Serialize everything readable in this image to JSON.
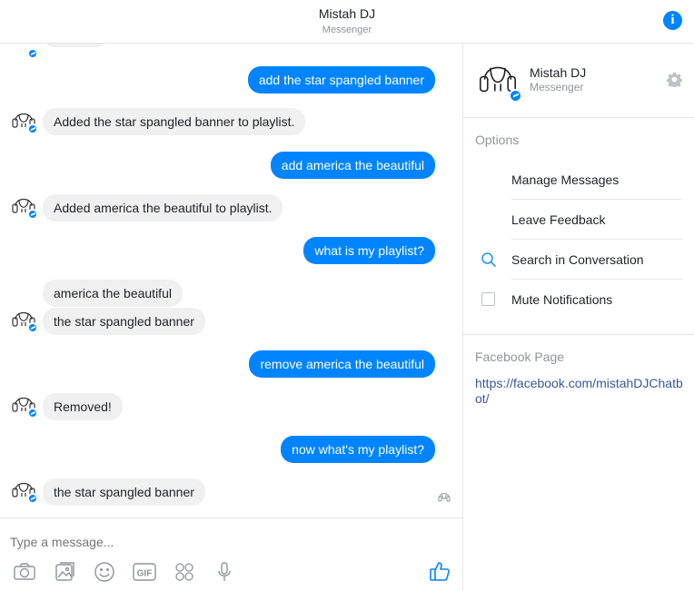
{
  "header": {
    "title": "Mistah DJ",
    "subtitle": "Messenger"
  },
  "conversation": {
    "messages": [
      {
        "direction": "out",
        "text": "add the star spangled banner"
      },
      {
        "direction": "in",
        "text": "Added the star spangled banner to playlist."
      },
      {
        "direction": "out",
        "text": "add america the beautiful"
      },
      {
        "direction": "in",
        "text": "Added america the beautiful to playlist."
      },
      {
        "direction": "out",
        "text": "what is my playlist?"
      },
      {
        "direction": "in",
        "text": "america the beautiful"
      },
      {
        "direction": "in",
        "text": "the star spangled banner"
      },
      {
        "direction": "out",
        "text": "remove america the beautiful"
      },
      {
        "direction": "in",
        "text": "Removed!"
      },
      {
        "direction": "out",
        "text": "now what's my playlist?"
      },
      {
        "direction": "in",
        "text": "the star spangled banner"
      }
    ]
  },
  "composer": {
    "placeholder": "Type a message...",
    "tools": [
      "camera-icon",
      "image-icon",
      "emoji-icon",
      "gif-icon",
      "stickers-icon",
      "microphone-icon"
    ],
    "send_icon": "thumbs-up-icon"
  },
  "panel": {
    "name": "Mistah DJ",
    "subtitle": "Messenger",
    "options_label": "Options",
    "options": [
      {
        "label": "Manage Messages"
      },
      {
        "label": "Leave Feedback"
      },
      {
        "label": "Search in Conversation",
        "icon": "search-icon"
      },
      {
        "label": "Mute Notifications",
        "icon": "checkbox"
      }
    ],
    "facebook_page_label": "Facebook Page",
    "facebook_page_url": "https://facebook.com/mistahDJChatbot/"
  },
  "colors": {
    "accent": "#0084ff",
    "incoming_bubble": "#f1f0f0",
    "link": "#365899",
    "muted_text": "#90949c"
  }
}
